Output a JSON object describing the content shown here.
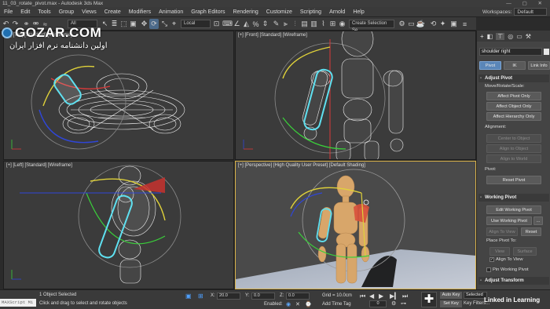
{
  "window": {
    "title": "11_03_rotate_pivot.max - Autodesk 3ds Max"
  },
  "menu": {
    "items": [
      "File",
      "Edit",
      "Tools",
      "Group",
      "Views",
      "Create",
      "Modifiers",
      "Animation",
      "Graph Editors",
      "Rendering",
      "Customize",
      "Scripting",
      "Arnold",
      "Help"
    ],
    "workspaces_label": "Workspaces:",
    "workspace_value": "Default"
  },
  "toolbar": {
    "filter_value": "All",
    "refcoord_value": "Local",
    "selset_value": "Create Selection Se"
  },
  "watermark": {
    "brand": "GOZAR.COM",
    "tagline": "اولین دانشنامه نرم افزار ایران"
  },
  "viewports": {
    "top_left": {
      "label": "[+] [Top] [Standard] [Wireframe]"
    },
    "top_right": {
      "label": "[+] [Front] [Standard] [Wireframe]"
    },
    "bottom_left": {
      "label": "[+] [Left] [Standard] [Wireframe]"
    },
    "bottom_right": {
      "label": "[+] [Perspective] [High Quality User Preset] [Default Shading]"
    }
  },
  "cmdpanel": {
    "object_name": "shoulder right",
    "tabs": [
      "Pivot",
      "IK",
      "Link Info"
    ],
    "adjust_pivot": {
      "title": "Adjust Pivot",
      "move_label": "Move/Rotate/Scale:",
      "affect_pivot": "Affect Pivot Only",
      "affect_object": "Affect Object Only",
      "affect_hierarchy": "Affect Hierarchy Only",
      "alignment_label": "Alignment:",
      "center_object": "Center to Object",
      "align_object": "Align to Object",
      "align_world": "Align to World",
      "pivot_label": "Pivot:",
      "reset_pivot": "Reset Pivot"
    },
    "working_pivot": {
      "title": "Working Pivot",
      "edit": "Edit Working Pivot",
      "use": "Use Working Pivot",
      "align_view": "Align To View",
      "reset": "Reset",
      "place_label": "Place Pivot To:",
      "view": "View",
      "surface": "Surface",
      "align_to_view": "Align To View",
      "pin": "Pin Working Pivot"
    },
    "adjust_transform": {
      "title": "Adjust Transform"
    }
  },
  "status": {
    "maxscript": "MAXScript Mi",
    "selected": "1 Object Selected",
    "prompt": "Click and drag to select and rotate objects",
    "x_label": "X:",
    "x_value": "20.0",
    "y_label": "Y:",
    "y_value": "0.0",
    "z_label": "Z:",
    "z_value": "0.0",
    "grid": "Grid = 10.0cm",
    "enabled": "Enabled:",
    "add_time_tag": "Add Time Tag",
    "frame": "0",
    "auto_key": "Auto Key",
    "set_key": "Set Key",
    "selected_dd": "Selected",
    "key_filters": "Key Filters...",
    "linkedin": "Linked in Learning"
  }
}
